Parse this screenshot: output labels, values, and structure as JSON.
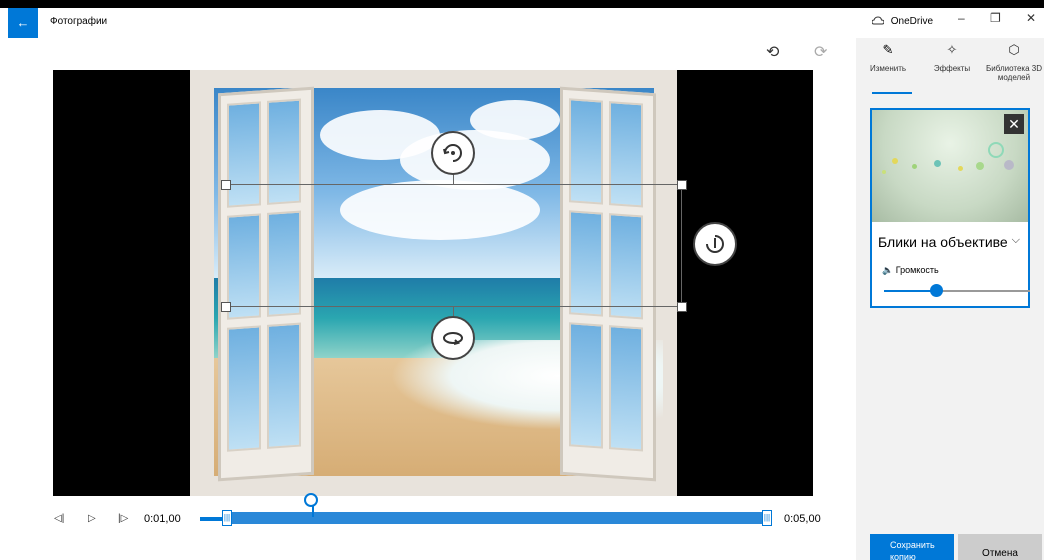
{
  "titlebar": {
    "back_icon": "←",
    "app_title": "Фотографии",
    "onedrive_label": "OneDrive",
    "minimize": "–",
    "restore": "❐",
    "close": "✕"
  },
  "toolbar": {
    "undo_icon": "⟲",
    "redo_icon": "⟳"
  },
  "timeline": {
    "prev_frame": "◁|",
    "play": "▷",
    "next_frame": "|▷",
    "start_time": "0:01,00",
    "end_time": "0:05,00",
    "trim_handle": "|||",
    "playhead_position_fraction": 0.19
  },
  "panel": {
    "tabs": [
      {
        "label": "Изменить",
        "icon": "✎"
      },
      {
        "label": "Эффекты",
        "icon": "✧"
      },
      {
        "label": "Библиотека 3D моделей",
        "icon": "⬡"
      }
    ],
    "effect": {
      "close_icon": "✕",
      "title": "Блики на объективе",
      "chevron": "⌵",
      "volume_icon": "🔈",
      "volume_label": "Громкость",
      "volume_fraction": 0.36
    },
    "save_button": "Сохранить копию",
    "cancel_button": "Отмена"
  },
  "colors": {
    "accent": "#0078d7",
    "panel_bg": "#f2f2f2"
  }
}
